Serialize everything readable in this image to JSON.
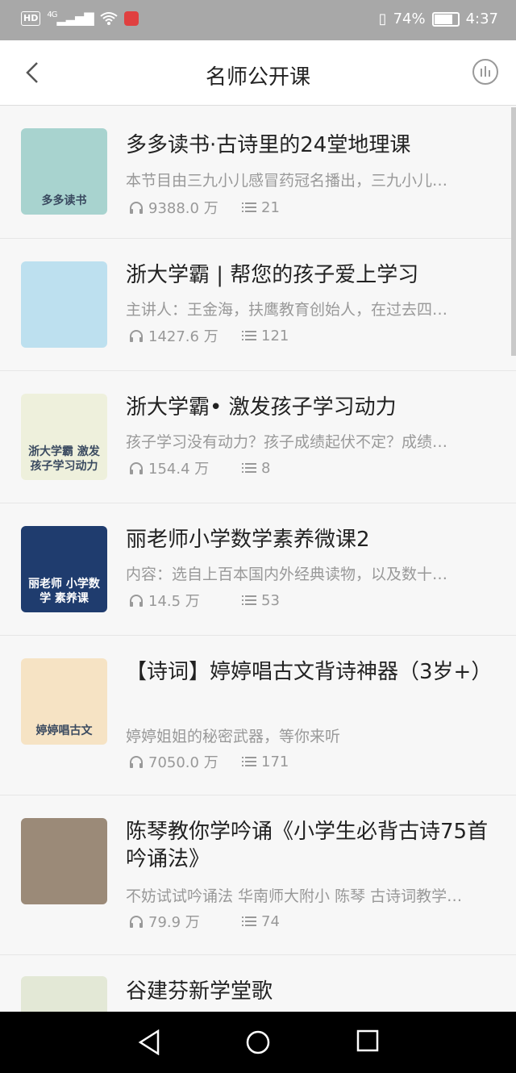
{
  "status_bar": {
    "hd_label": "HD",
    "network": "4G",
    "battery_percent": "74%",
    "battery_level": 0.74,
    "time": "4:37"
  },
  "header": {
    "title": "名师公开课"
  },
  "courses": [
    {
      "title": "多多读书·古诗里的24堂地理课",
      "desc": "本节目由三九小儿感冒药冠名播出，三九小儿…",
      "plays": "9388.0 万",
      "episodes": "21",
      "thumb_text": "多多读书",
      "thumb_color": "#a8d3cf"
    },
    {
      "title": "浙大学霸 | 帮您的孩子爱上学习",
      "desc": "主讲人：王金海，扶鹰教育创始人，在过去四…",
      "plays": "1427.6 万",
      "episodes": "121",
      "thumb_text": "",
      "thumb_color": "#bde0ef"
    },
    {
      "title": "浙大学霸• 激发孩子学习动力",
      "desc": "孩子学习没有动力？孩子成绩起伏不定？成绩…",
      "plays": "154.4 万",
      "episodes": "8",
      "thumb_text": "浙大学霸 激发孩子学习动力",
      "thumb_color": "#eef0dc"
    },
    {
      "title": "丽老师小学数学素养微课2",
      "desc": "内容：选自上百本国内外经典读物，以及数十…",
      "plays": "14.5 万",
      "episodes": "53",
      "thumb_text": "丽老师 小学数学 素养课",
      "thumb_color": "#1f3c6e"
    },
    {
      "title": "【诗词】婷婷唱古文背诗神器（3岁+）",
      "desc": "婷婷姐姐的秘密武器，等你来听",
      "plays": "7050.0 万",
      "episodes": "171",
      "thumb_text": "婷婷唱古文",
      "thumb_color": "#f6e3c4"
    },
    {
      "title": "陈琴教你学吟诵《小学生必背古诗75首吟诵法》",
      "desc": "不妨试试吟诵法 华南师大附小 陈琴 古诗词教学…",
      "plays": "79.9 万",
      "episodes": "74",
      "thumb_text": "",
      "thumb_color": "#9b8a78"
    },
    {
      "title": "谷建芬新学堂歌",
      "desc": "",
      "plays": "",
      "episodes": "",
      "thumb_text": "",
      "thumb_color": "#e3e8d6"
    }
  ]
}
